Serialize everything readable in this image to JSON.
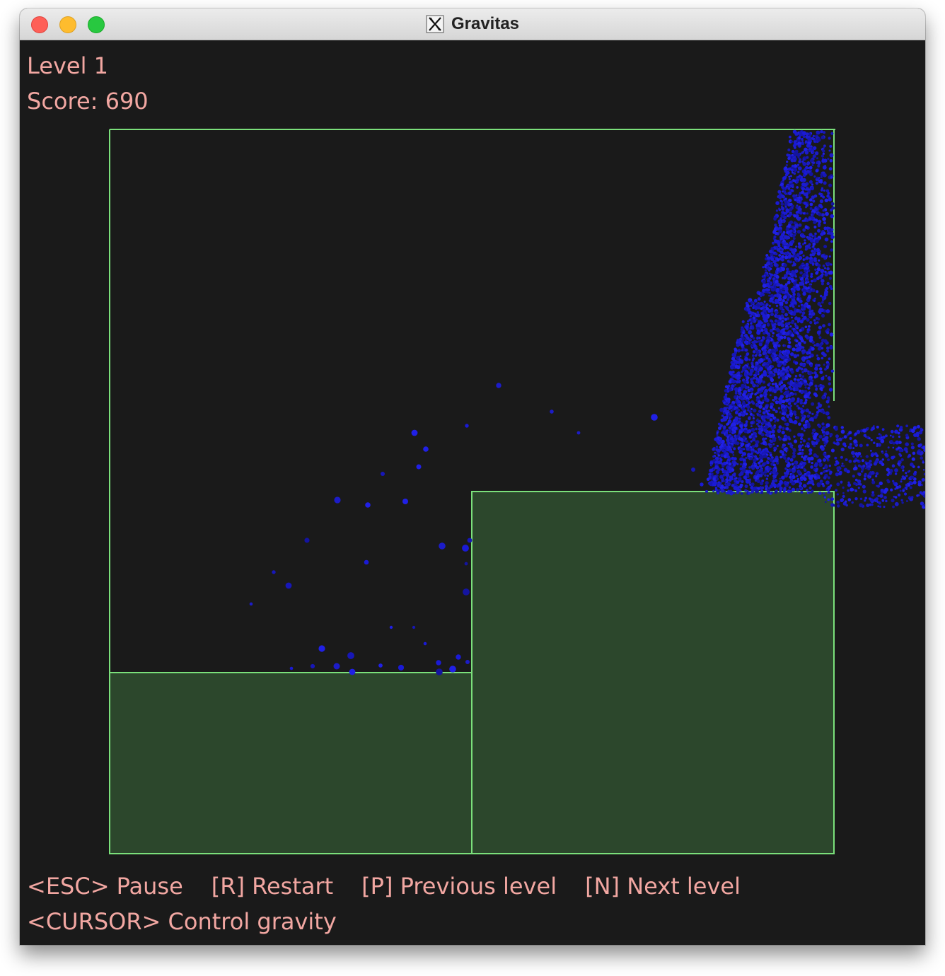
{
  "window": {
    "title": "Gravitas",
    "app_icon": "x11-icon"
  },
  "hud": {
    "level": "Level 1",
    "score": "Score: 690"
  },
  "help": {
    "pause": "<ESC> Pause",
    "restart": "[R] Restart",
    "previous": "[P] Previous level",
    "next": "[N] Next level",
    "control": "<CURSOR> Control gravity"
  },
  "colors": {
    "background": "#1a1a1a",
    "wall_outline": "#7be07b",
    "platform_fill": "#2c472c",
    "fluid": "#1c1ccf",
    "hud_text": "#f2a7a2"
  }
}
